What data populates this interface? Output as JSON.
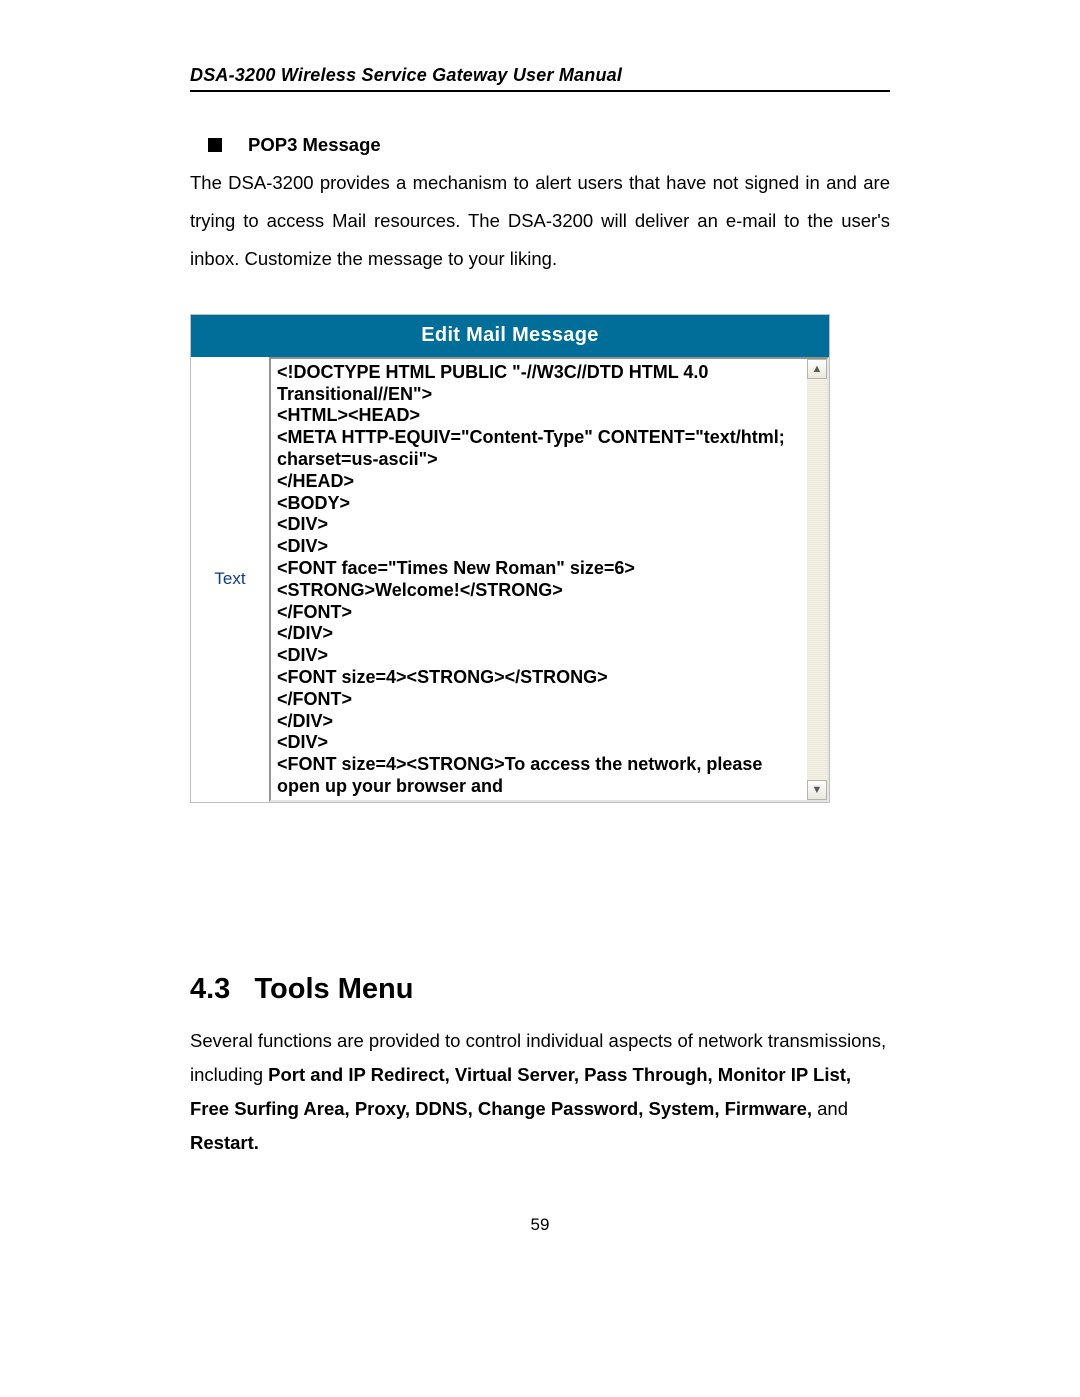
{
  "header": {
    "title": "DSA-3200 Wireless Service Gateway User Manual"
  },
  "pop3": {
    "title": "POP3 Message",
    "paragraph": "The DSA-3200 provides a mechanism to alert users that have not signed in and are trying to access Mail resources. The DSA-3200 will deliver an e-mail to the user's inbox. Customize the message to your liking."
  },
  "panel": {
    "title": "Edit Mail Message",
    "label": "Text",
    "html_source": "<!DOCTYPE HTML PUBLIC \"-//W3C//DTD HTML 4.0 Transitional//EN\">\n<HTML><HEAD>\n<META HTTP-EQUIV=\"Content-Type\" CONTENT=\"text/html; charset=us-ascii\">\n</HEAD>\n<BODY>\n<DIV>\n<DIV>\n<FONT face=\"Times New Roman\" size=6>\n<STRONG>Welcome!</STRONG>\n</FONT>\n</DIV>\n<DIV>\n<FONT size=4><STRONG></STRONG>\n</FONT>\n</DIV>\n<DIV>\n<FONT size=4><STRONG>To access the network, please open up your browser and"
  },
  "section": {
    "number": "4.3",
    "title": "Tools Menu",
    "intro_pre": "Several functions are provided to control individual aspects of network transmissions, including ",
    "bold_list": "Port and IP Redirect, Virtual Server, Pass Through, Monitor IP List, Free Surfing Area, Proxy, DDNS, Change Password, System, Firmware,",
    "intro_mid": " and ",
    "bold_tail": "Restart."
  },
  "page_number": "59"
}
